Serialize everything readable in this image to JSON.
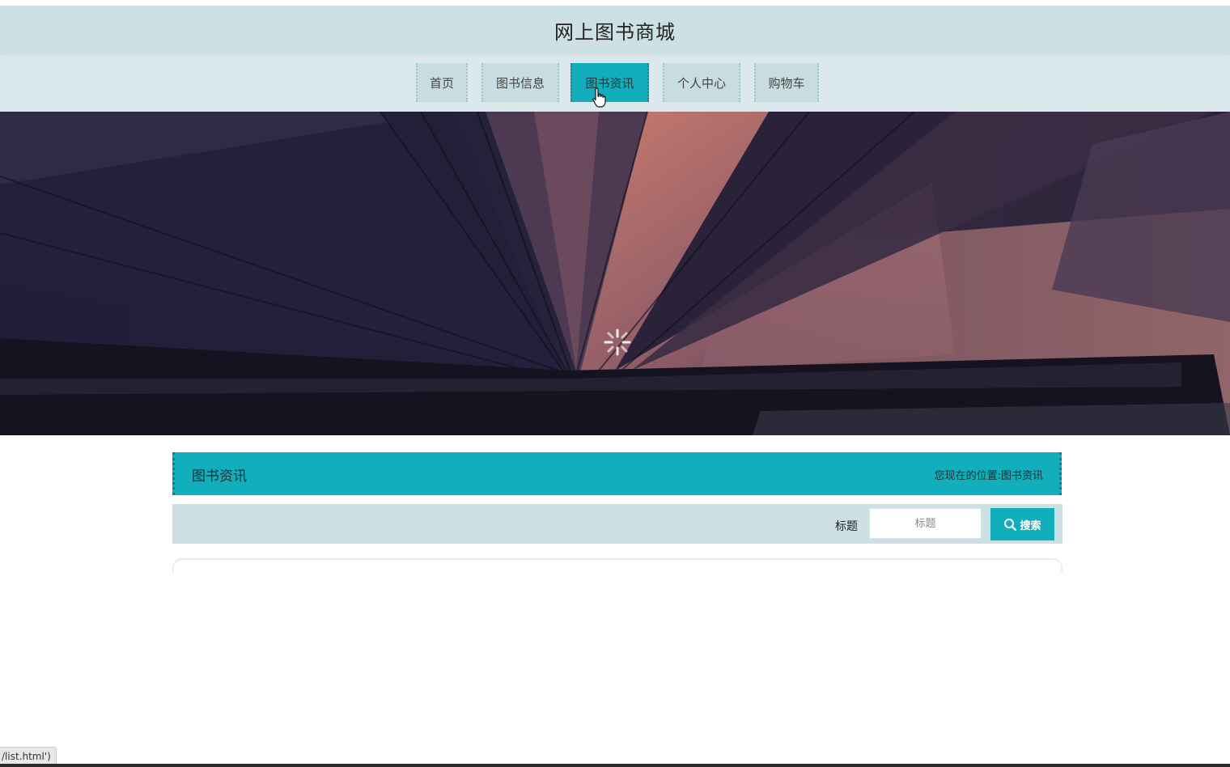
{
  "header": {
    "title": "网上图书商城"
  },
  "nav": {
    "items": [
      {
        "label": "首页"
      },
      {
        "label": "图书信息"
      },
      {
        "label": "图书资讯"
      },
      {
        "label": "个人中心"
      },
      {
        "label": "购物车"
      }
    ],
    "active_label": "图书资讯"
  },
  "section": {
    "title": "图书资讯",
    "breadcrumb_prefix": "您现在的位置:",
    "breadcrumb_current": "图书资讯"
  },
  "search": {
    "label": "标题",
    "placeholder": "标题",
    "value": "",
    "button_label": "搜索"
  },
  "status_bar": {
    "url_text": "/list.html')"
  },
  "colors": {
    "accent": "#12aebb",
    "header_bg": "#cde0e4",
    "nav_bg": "#dbe8ee",
    "nav_item_bg": "#c8dde1"
  },
  "icons": {
    "search_button": "search-icon",
    "loading": "loading-spinner-icon",
    "cursor": "hand-pointer-icon"
  }
}
